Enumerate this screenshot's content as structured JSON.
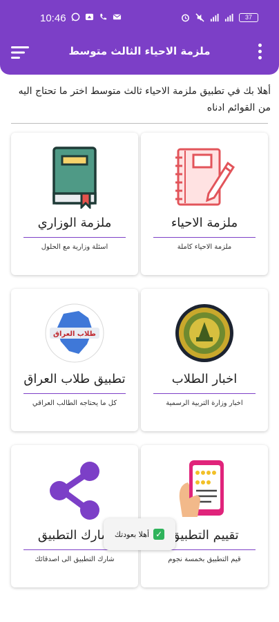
{
  "status": {
    "time": "10:46",
    "battery": "37",
    "left_icons": [
      "whatsapp-icon",
      "cloud-icon",
      "call-icon",
      "mail-icon"
    ],
    "right_icons": [
      "alarm-icon",
      "mute-icon",
      "signal-icon",
      "signal-icon",
      "battery-icon"
    ]
  },
  "app_bar": {
    "title": "ملزمة الاحياء الثالث متوسط",
    "color": "#7c3fc7"
  },
  "welcome_text": "أهلا بك في تطبيق ملزمة الاحياء ثالث متوسط اختر ما تحتاج اليه من القوائم ادناه",
  "cards": [
    {
      "title": "ملزمة الاحياء",
      "subtitle": "ملزمة الاحياء كاملة",
      "icon": "notebook-pen-icon"
    },
    {
      "title": "ملزمة الوزاري",
      "subtitle": "اسئلة وزارية مع الحلول",
      "icon": "book-icon"
    },
    {
      "title": "اخبار الطلاب",
      "subtitle": "اخبار وزارة التربية الرسمية",
      "icon": "ministry-seal-icon"
    },
    {
      "title": "تطبيق طلاب العراق",
      "subtitle": "كل ما يحتاجه الطالب العراقي",
      "icon": "iraq-map-logo-icon",
      "logo_text": "طلاب العراق"
    },
    {
      "title": "تقييم التطبيق",
      "subtitle": "قيم التطبيق بخمسة نجوم",
      "icon": "phone-rating-icon"
    },
    {
      "title": "شارك التطبيق",
      "subtitle": "شارك التطبيق الى اصدقائك",
      "icon": "share-icon"
    }
  ],
  "toast": {
    "text": "أهلا بعودتك"
  }
}
